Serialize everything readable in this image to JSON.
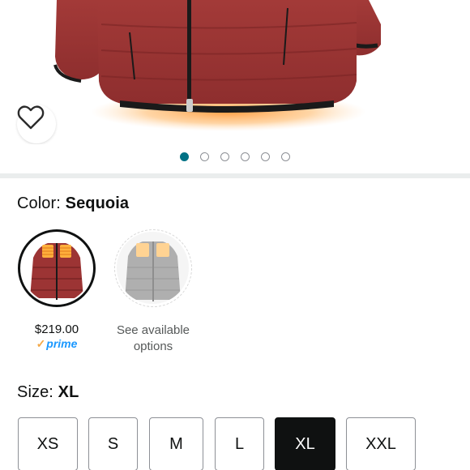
{
  "product_image": {
    "image_name": "red-heated-puffer-jacket",
    "jacket_color": "#b03a3a",
    "heat_glow_color": "#ff9a3c"
  },
  "wishlist": {
    "icon": "heart-outline-icon"
  },
  "carousel": {
    "dot_count": 6,
    "active_index": 0,
    "active_color": "#007185"
  },
  "color_section": {
    "label": "Color:",
    "selected_value": "Sequoia",
    "options": [
      {
        "name": "Sequoia",
        "price": "$219.00",
        "prime_check": "✓",
        "prime_label": "prime",
        "selected": true
      },
      {
        "name": "other-colors",
        "note_line1": "See available",
        "note_line2": "options",
        "selected": false
      }
    ]
  },
  "size_section": {
    "label": "Size:",
    "selected_value": "XL",
    "options": [
      {
        "label": "XS",
        "selected": false
      },
      {
        "label": "S",
        "selected": false
      },
      {
        "label": "M",
        "selected": false
      },
      {
        "label": "L",
        "selected": false
      },
      {
        "label": "XL",
        "selected": true
      },
      {
        "label": "XXL",
        "selected": false
      }
    ]
  }
}
